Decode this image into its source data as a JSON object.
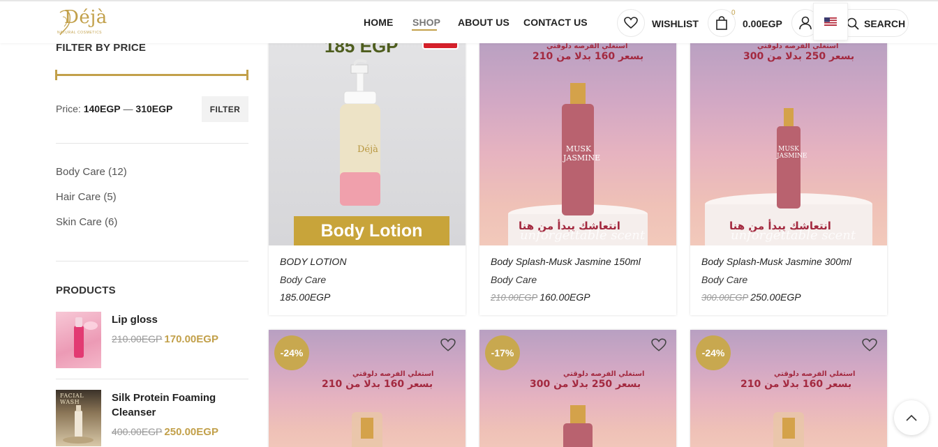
{
  "header": {
    "logo_text": "Déjà",
    "logo_subtext": "NATURAL COSMETICS",
    "nav": [
      {
        "label": "HOME"
      },
      {
        "label": "SHOP"
      },
      {
        "label": "ABOUT US"
      },
      {
        "label": "CONTACT US"
      }
    ],
    "wishlist_label": "WISHLIST",
    "cart_count": "0",
    "cart_total": "0.00EGP",
    "search_label": "SEARCH"
  },
  "sidebar": {
    "filter_title": "FILTER BY PRICE",
    "price_prefix": "Price:",
    "price_min": "140EGP",
    "price_sep": "—",
    "price_max": "310EGP",
    "filter_button": "FILTER",
    "categories": [
      {
        "label": "Body Care (12)"
      },
      {
        "label": "Hair Care (5)"
      },
      {
        "label": "Skin Care (6)"
      }
    ],
    "products_title": "PRODUCTS",
    "products": [
      {
        "name": "Lip gloss",
        "old_price": "210.00EGP",
        "price": "170.00EGP"
      },
      {
        "name": "Silk Protein Foaming Cleanser",
        "old_price": "400.00EGP",
        "price": "250.00EGP",
        "thumb_text": "FACIAL WASH"
      }
    ]
  },
  "products": [
    {
      "title": "BODY LOTION",
      "category": "Body Care",
      "old_price": "",
      "price": "185.00EGP",
      "img_top_text": "185 EGP",
      "img_banner": "Body Lotion",
      "bottle_label": "Déjà"
    },
    {
      "title": "Body Splash-Musk Jasmine 150ml",
      "category": "Body Care",
      "old_price": "210.00EGP",
      "price": "160.00EGP",
      "arabic_top": "استغلي الفرصه دلوقتي",
      "arabic_offer": "بسعر 160 بدلا من 210",
      "bottle_label": "MUSK JASMINE",
      "arabic_bottom": "انتعاشك يبدأ من هنا",
      "script_text": "unforgettable scent"
    },
    {
      "title": "Body Splash-Musk Jasmine 300ml",
      "category": "Body Care",
      "old_price": "300.00EGP",
      "price": "250.00EGP",
      "arabic_top": "استغلي الفرصه دلوقتي",
      "arabic_offer": "بسعر 250 بدلا من 300",
      "bottle_label": "MUSK JASMINE",
      "arabic_bottom": "انتعاشك يبدأ من هنا",
      "script_text": "unforgettable scent"
    }
  ],
  "products_row2": [
    {
      "badge": "-24%",
      "arabic_top": "استغلي الفرصه دلوقتي",
      "arabic_offer": "بسعر 160 بدلا من 210"
    },
    {
      "badge": "-17%",
      "arabic_top": "استغلي الفرصه دلوقتي",
      "arabic_offer": "بسعر 250 بدلا من 300"
    },
    {
      "badge": "-24%",
      "arabic_top": "استغلي الفرصه دلوقتي",
      "arabic_offer": "بسعر 160 بدلا من 210"
    }
  ],
  "colors": {
    "accent": "#c2a04a",
    "badge": "#c8a84f",
    "arabic_red": "#a3293f"
  }
}
